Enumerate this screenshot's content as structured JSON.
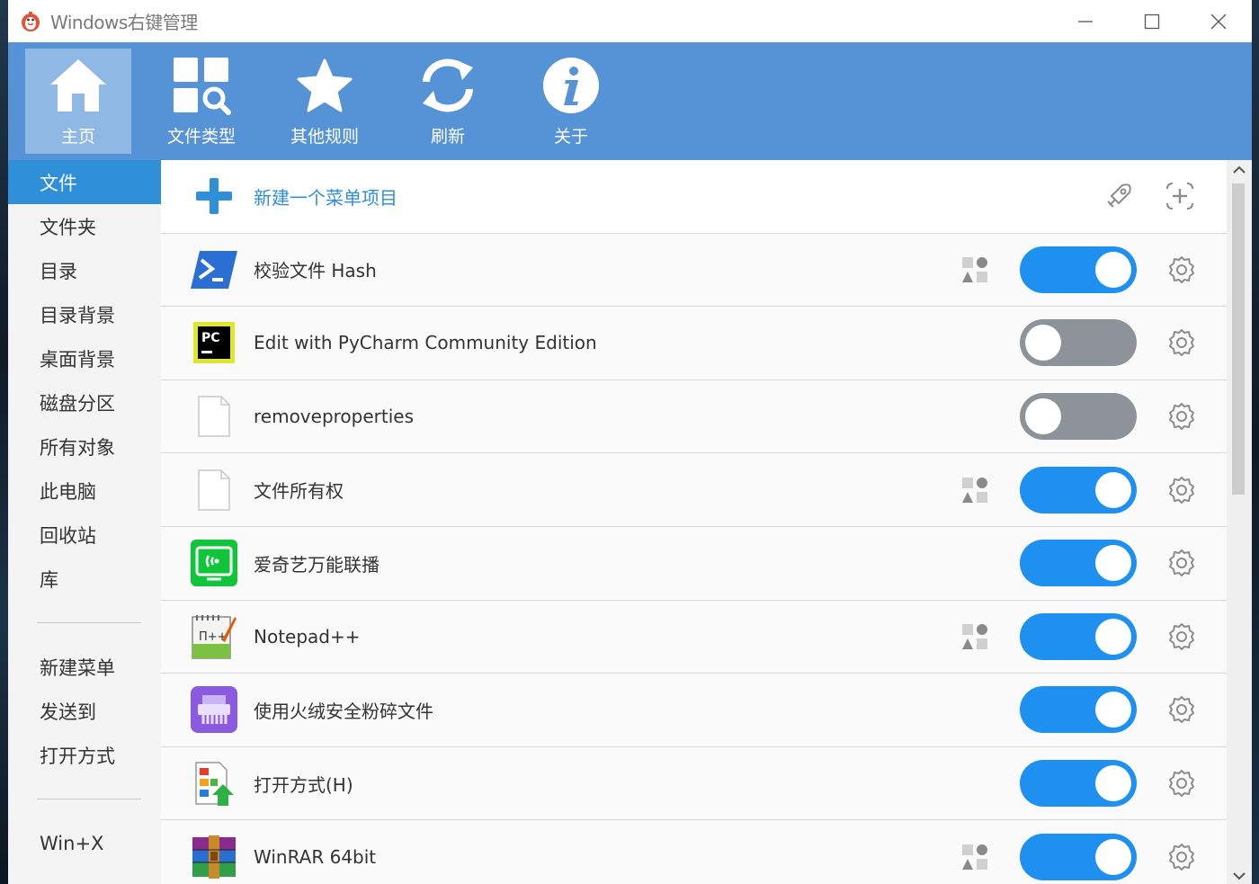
{
  "window": {
    "title": "Windows右键管理"
  },
  "toolbar": {
    "items": [
      {
        "label": "主页",
        "icon": "home-icon",
        "active": true
      },
      {
        "label": "文件类型",
        "icon": "file-type-icon",
        "active": false
      },
      {
        "label": "其他规则",
        "icon": "star-icon",
        "active": false
      },
      {
        "label": "刷新",
        "icon": "refresh-icon",
        "active": false
      },
      {
        "label": "关于",
        "icon": "info-icon",
        "active": false
      }
    ]
  },
  "sidebar": {
    "group1": [
      "文件",
      "文件夹",
      "目录",
      "目录背景",
      "桌面背景",
      "磁盘分区",
      "所有对象",
      "此电脑",
      "回收站",
      "库"
    ],
    "group2": [
      "新建菜单",
      "发送到",
      "打开方式"
    ],
    "group3": [
      "Win+X"
    ],
    "active_index": 0
  },
  "content": {
    "new_item_label": "新建一个菜单项目",
    "rows": [
      {
        "label": "校验文件 Hash",
        "icon": "powershell-icon",
        "enabled": true,
        "group_icon": true
      },
      {
        "label": "Edit with PyCharm Community Edition",
        "icon": "pycharm-icon",
        "enabled": false,
        "group_icon": false
      },
      {
        "label": "removeproperties",
        "icon": "blank-file-icon",
        "enabled": false,
        "group_icon": false
      },
      {
        "label": "文件所有权",
        "icon": "blank-file-icon",
        "enabled": true,
        "group_icon": true
      },
      {
        "label": "爱奇艺万能联播",
        "icon": "iqiyi-cast-icon",
        "enabled": true,
        "group_icon": false
      },
      {
        "label": "Notepad++",
        "icon": "notepadpp-icon",
        "enabled": true,
        "group_icon": true
      },
      {
        "label": "使用火绒安全粉碎文件",
        "icon": "huorong-shredder-icon",
        "enabled": true,
        "group_icon": false
      },
      {
        "label": "打开方式(H)",
        "icon": "open-with-icon",
        "enabled": true,
        "group_icon": false
      },
      {
        "label": "WinRAR 64bit",
        "icon": "winrar-icon",
        "enabled": true,
        "group_icon": true
      }
    ]
  },
  "colors": {
    "toolbar": "#5592d6",
    "accent": "#2f8fd8",
    "toggle_on": "#1e90f0",
    "toggle_off": "#8e9399"
  }
}
